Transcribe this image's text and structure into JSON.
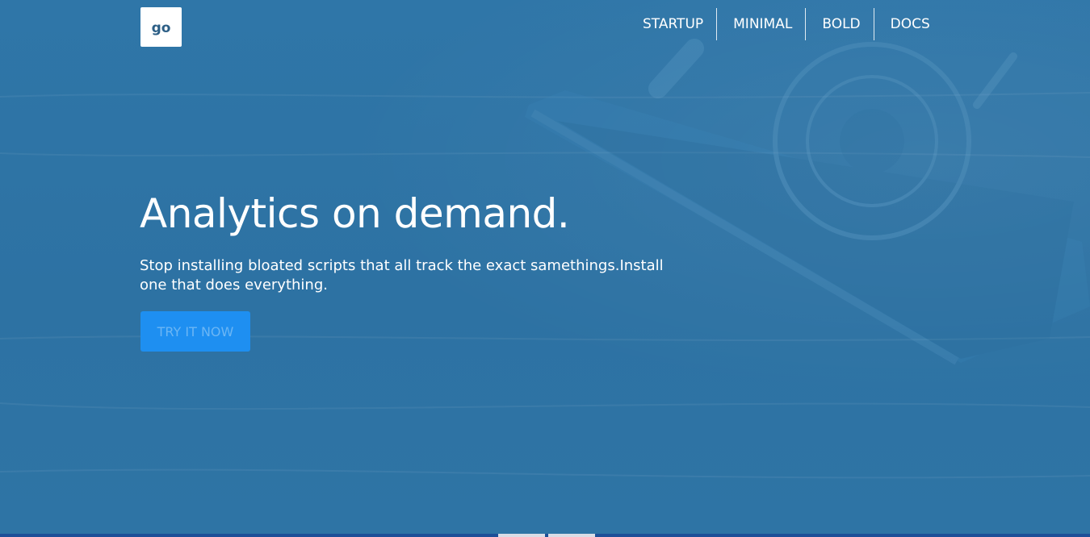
{
  "logo": {
    "text": "go"
  },
  "nav": {
    "items": [
      {
        "label": "STARTUP"
      },
      {
        "label": "MINIMAL"
      },
      {
        "label": "BOLD"
      },
      {
        "label": "DOCS"
      }
    ]
  },
  "hero": {
    "title": "Analytics on demand.",
    "subtitle": "Stop installing bloated scripts that all track the exact samethings.Install one that does everything.",
    "cta_label": "TRY IT NOW",
    "background_image": "camera-on-wooden-desk"
  },
  "colors": {
    "background": "#2f74a5",
    "button": "#1e8ff1",
    "button_text": "#6bb6f5",
    "logo_text": "#2d5f86",
    "taskbar": "#1d4f98"
  }
}
